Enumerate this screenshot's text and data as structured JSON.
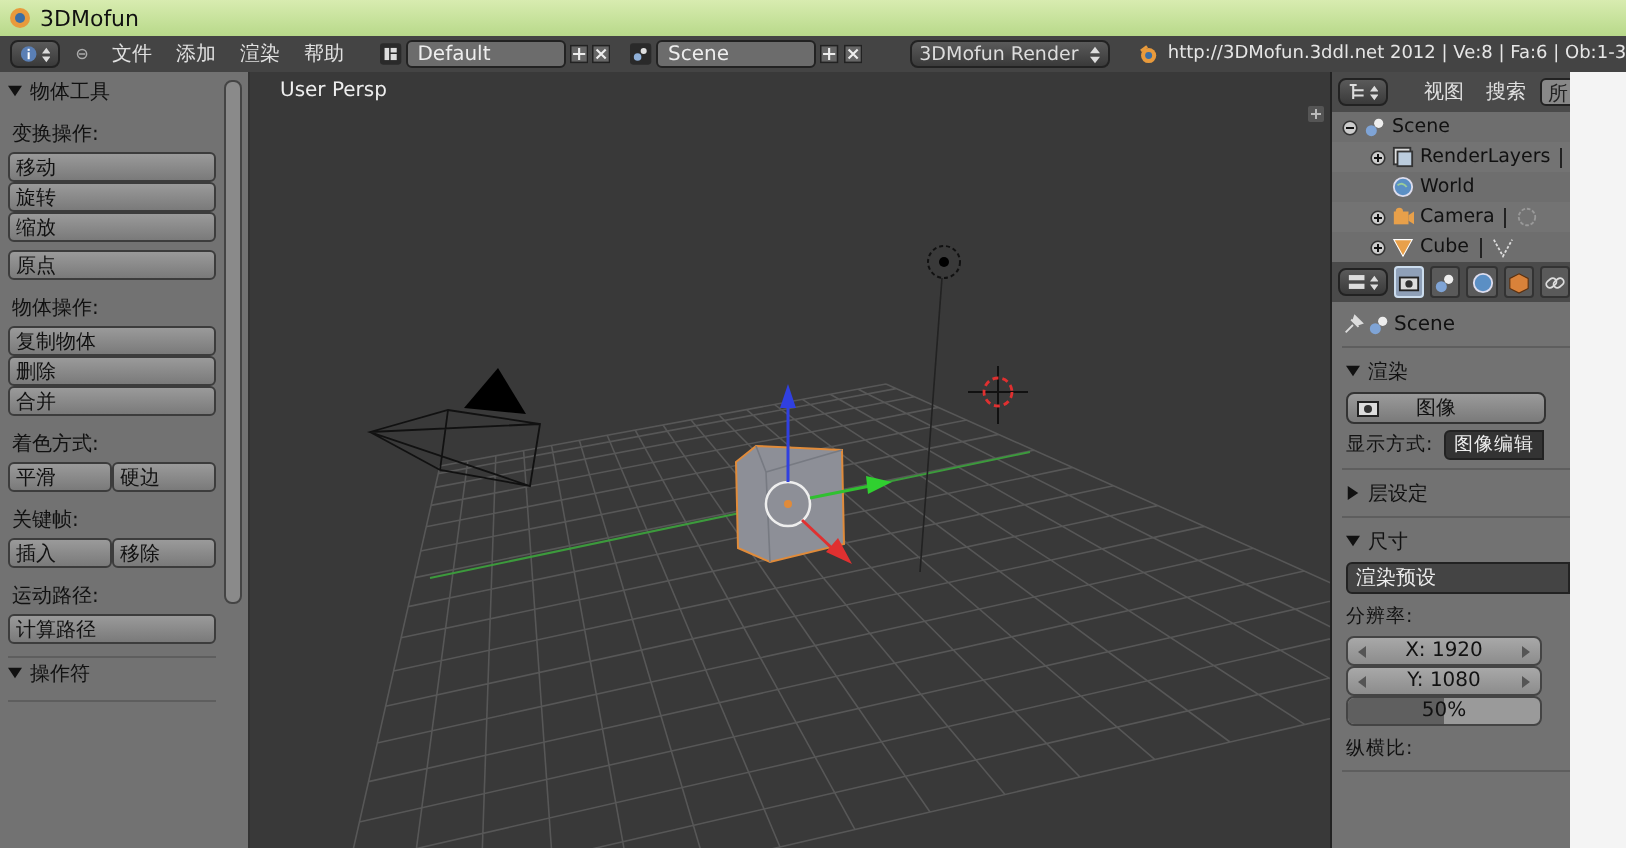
{
  "window": {
    "title": "3DMofun"
  },
  "header": {
    "menus": [
      "文件",
      "添加",
      "渲染",
      "帮助"
    ],
    "layout": {
      "value": "Default"
    },
    "scene": {
      "value": "Scene"
    },
    "render_engine": "3DMofun Render",
    "stats": "http://3DMofun.3ddl.net 2012 | Ve:8 | Fa:6 | Ob:1-3"
  },
  "tool_shelf": {
    "panels": [
      {
        "title": "物体工具",
        "expanded": true,
        "blocks": [
          {
            "label": "变换操作:",
            "rows": [
              [
                "移动"
              ],
              [
                "旋转"
              ],
              [
                "缩放"
              ]
            ]
          },
          {
            "rows": [
              [
                "原点"
              ]
            ]
          },
          {
            "label": "物体操作:",
            "rows": [
              [
                "复制物体"
              ],
              [
                "删除"
              ],
              [
                "合并"
              ]
            ]
          },
          {
            "label": "着色方式:",
            "rows": [
              [
                "平滑",
                "硬边"
              ]
            ]
          },
          {
            "label": "关键帧:",
            "rows": [
              [
                "插入",
                "移除"
              ]
            ]
          },
          {
            "label": "运动路径:",
            "rows": [
              [
                "计算路径"
              ]
            ]
          }
        ]
      },
      {
        "title": "操作符",
        "expanded": true
      }
    ]
  },
  "viewport": {
    "label": "User Persp"
  },
  "outliner": {
    "menus": [
      "视图",
      "搜索"
    ],
    "filter": "所",
    "tree": [
      {
        "name": "Scene",
        "kind": "scene",
        "expanded": true,
        "children": [
          {
            "name": "RenderLayers",
            "kind": "render_layers",
            "expanded": false
          },
          {
            "name": "World",
            "kind": "world"
          },
          {
            "name": "Camera",
            "kind": "camera",
            "expanded": false
          },
          {
            "name": "Cube",
            "kind": "mesh",
            "expanded": false
          }
        ]
      }
    ]
  },
  "properties": {
    "tabs": [
      {
        "kind": "render",
        "selected": true
      },
      {
        "kind": "scene",
        "selected": false
      },
      {
        "kind": "world",
        "selected": false
      },
      {
        "kind": "object",
        "selected": false
      },
      {
        "kind": "constraints",
        "selected": false
      }
    ],
    "context": "Scene",
    "render_panel": {
      "title": "渲染",
      "expanded": true,
      "render_button": "图像",
      "display_label": "显示方式:",
      "display_value": "图像编辑"
    },
    "layers_panel": {
      "title": "层设定",
      "expanded": false
    },
    "dimensions_panel": {
      "title": "尺寸",
      "expanded": true,
      "preset": "渲染预设",
      "resolution_label": "分辨率:",
      "x": "X: 1920",
      "y": "Y: 1080",
      "percentage": {
        "reading": "50%",
        "level": 0.5
      },
      "aspect_label": "纵横比:"
    }
  }
}
